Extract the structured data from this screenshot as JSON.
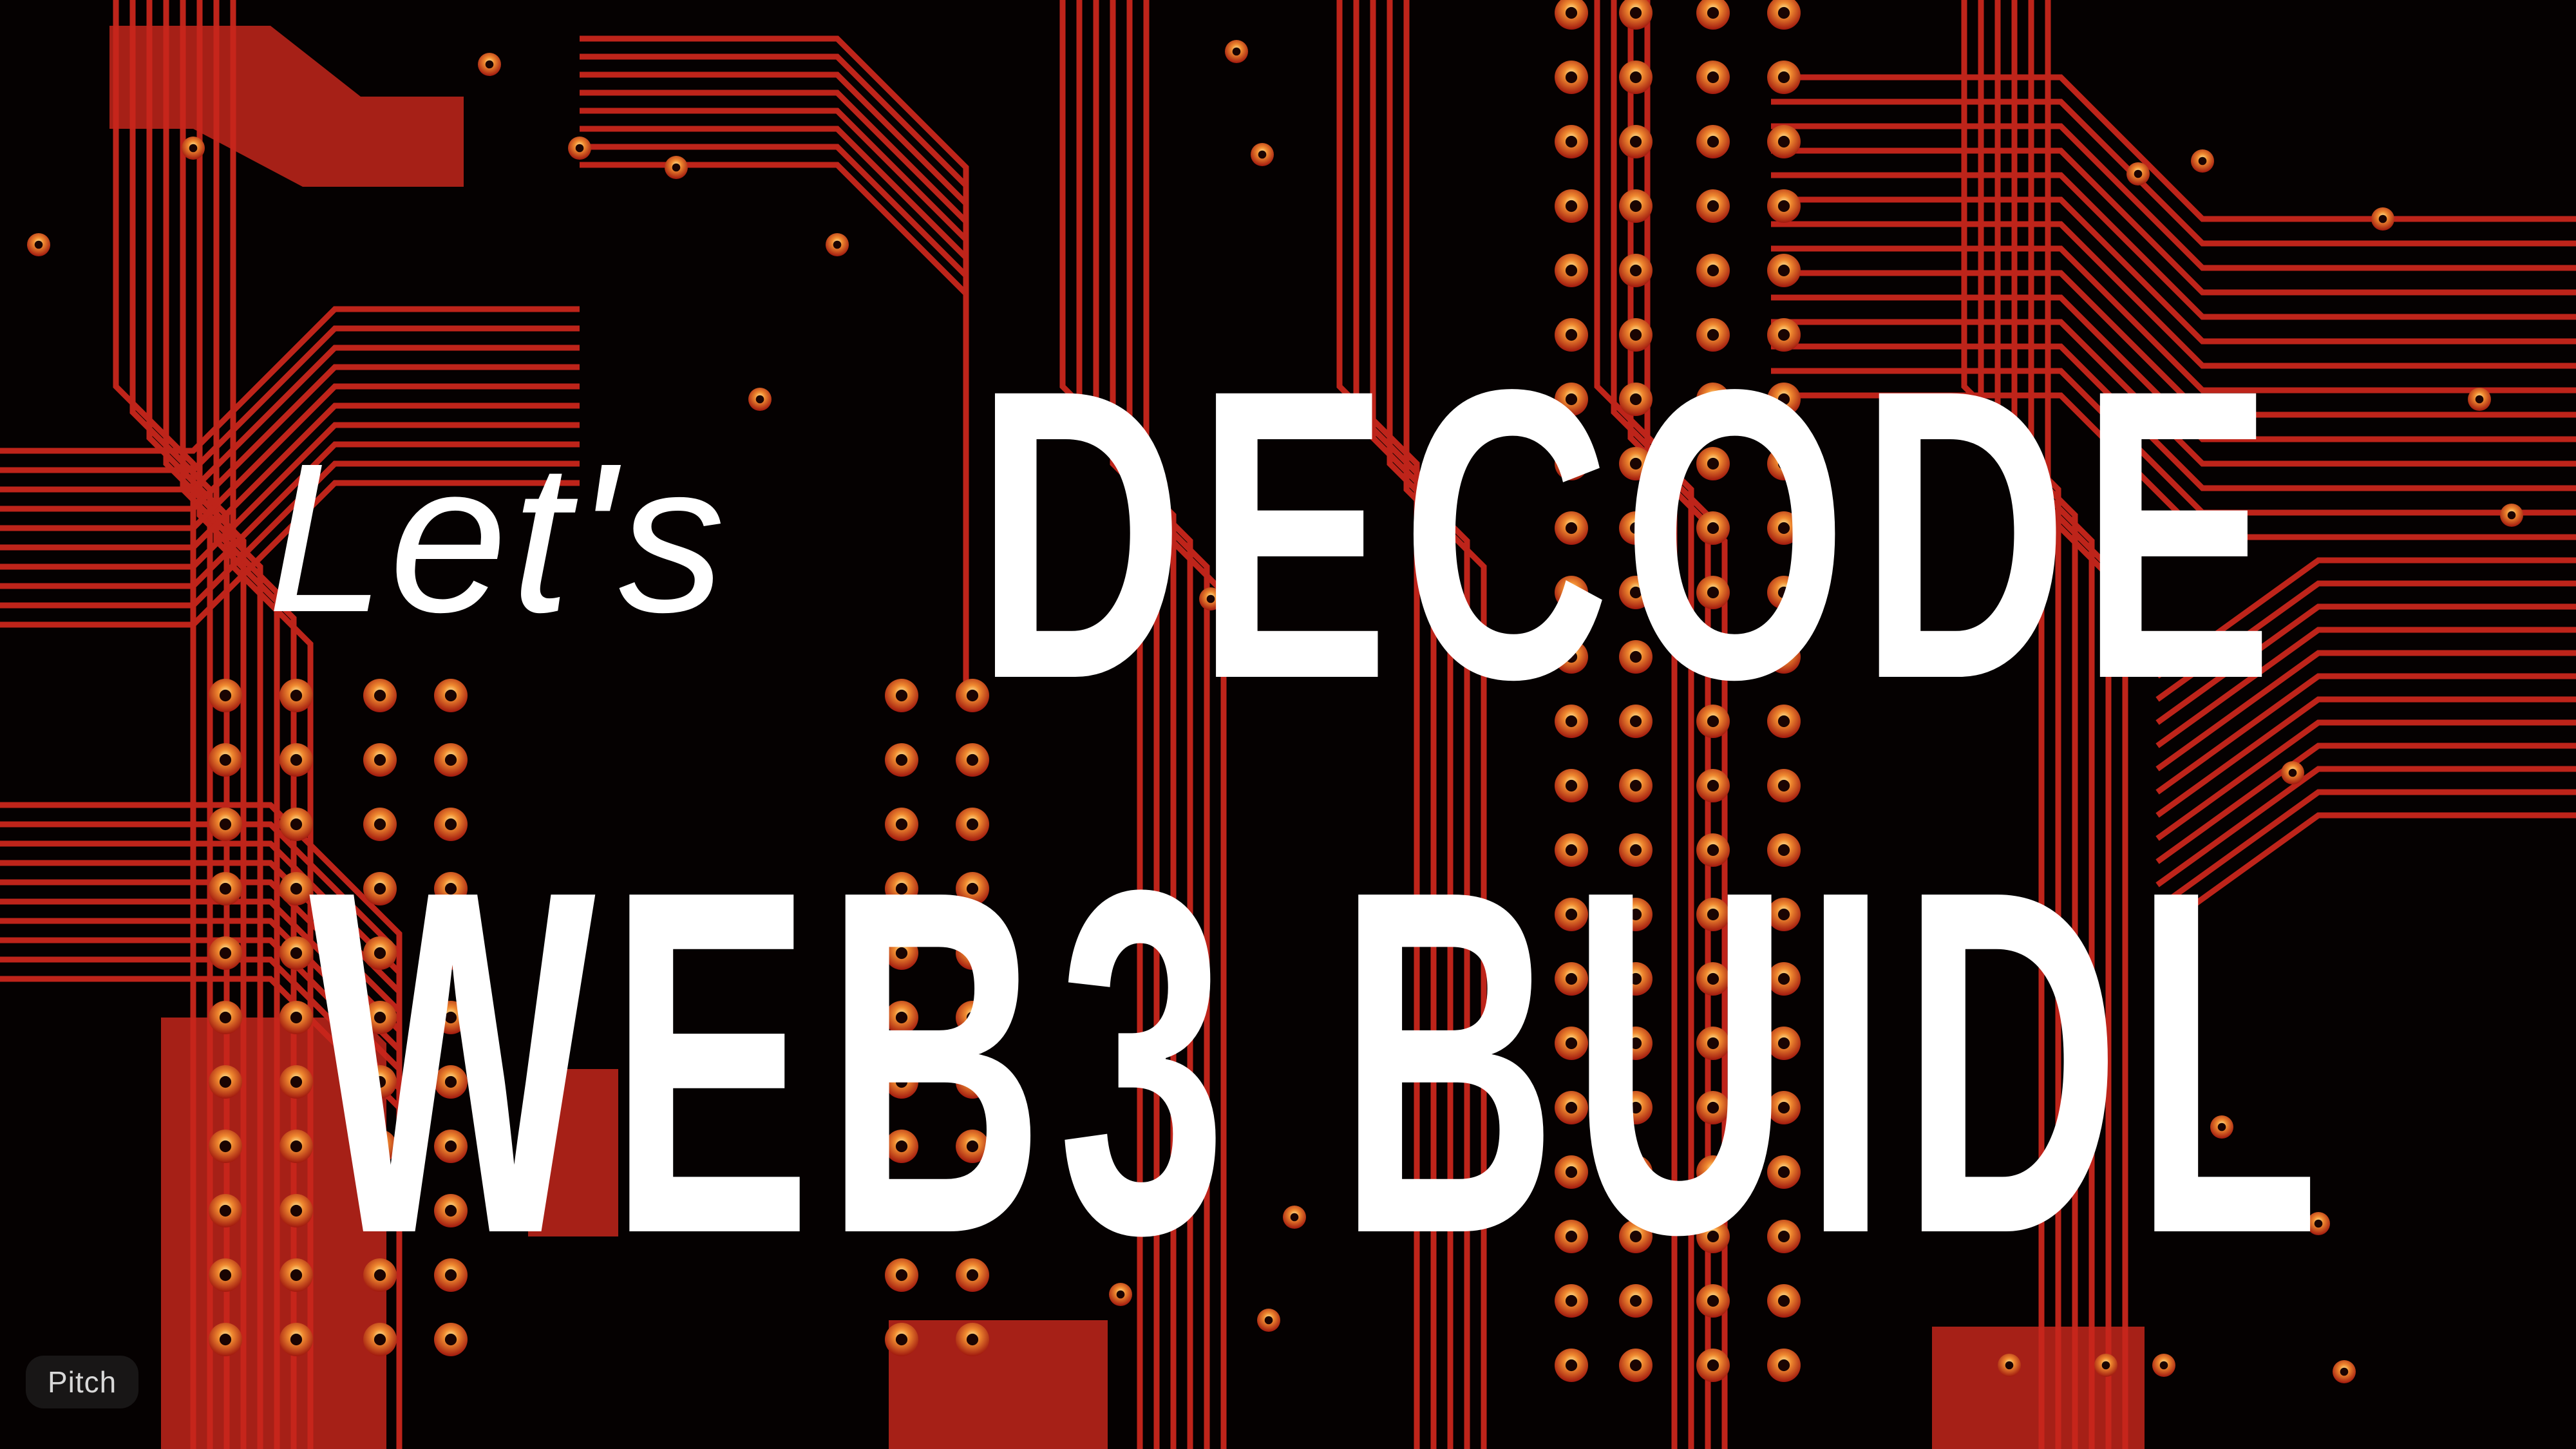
{
  "slide": {
    "lets": "Let's",
    "line1": "DECODE",
    "line2": "WEB3 BUIDL"
  },
  "badge": {
    "label": "Pitch"
  },
  "background": {
    "image": "circuit-board-photo",
    "colors": {
      "base": "#050101",
      "trace": "#c8261c",
      "pad": "#e03a1c",
      "highlight": "#ffd060"
    }
  }
}
